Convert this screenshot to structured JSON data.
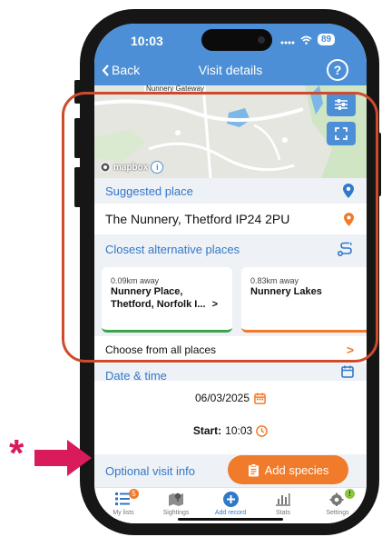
{
  "status": {
    "time": "10:03",
    "battery": "89"
  },
  "nav": {
    "back_label": "Back",
    "title": "Visit details",
    "help_icon": "?"
  },
  "map": {
    "road_label": "Nunnery Gateway",
    "attribution": "mapbox",
    "info_icon": "i"
  },
  "suggested": {
    "header": "Suggested place",
    "place": "The Nunnery, Thetford IP24 2PU"
  },
  "alternatives": {
    "header": "Closest alternative places",
    "cards": [
      {
        "distance": "0.09km away",
        "name_line1": "Nunnery Place,",
        "name_line2": "Thetford, Norfolk I...",
        "chevron": ">"
      },
      {
        "distance": "0.83km away",
        "name_line1": "Nunnery Lakes",
        "name_line2": ""
      }
    ]
  },
  "choose_all": {
    "label": "Choose from all places",
    "chevron": ">"
  },
  "datetime": {
    "header": "Date & time",
    "date": "06/03/2025",
    "start_label": "Start:",
    "start_time": "10:03"
  },
  "optional": {
    "label": "Optional visit info",
    "add_species_label": "Add species"
  },
  "tabs": [
    {
      "label": "My lists",
      "badge": "5"
    },
    {
      "label": "Sightings"
    },
    {
      "label": "Add record"
    },
    {
      "label": "Stats"
    },
    {
      "label": "Settings",
      "badge": "!"
    }
  ],
  "annotation": {
    "asterisk": "*"
  },
  "colors": {
    "primary_blue": "#4d8fd6",
    "link_blue": "#3278c8",
    "orange": "#f07b2a",
    "annotation_red": "#cf4a2c",
    "annotation_pink": "#d91a5b",
    "green_tab": "#3fa34d"
  }
}
